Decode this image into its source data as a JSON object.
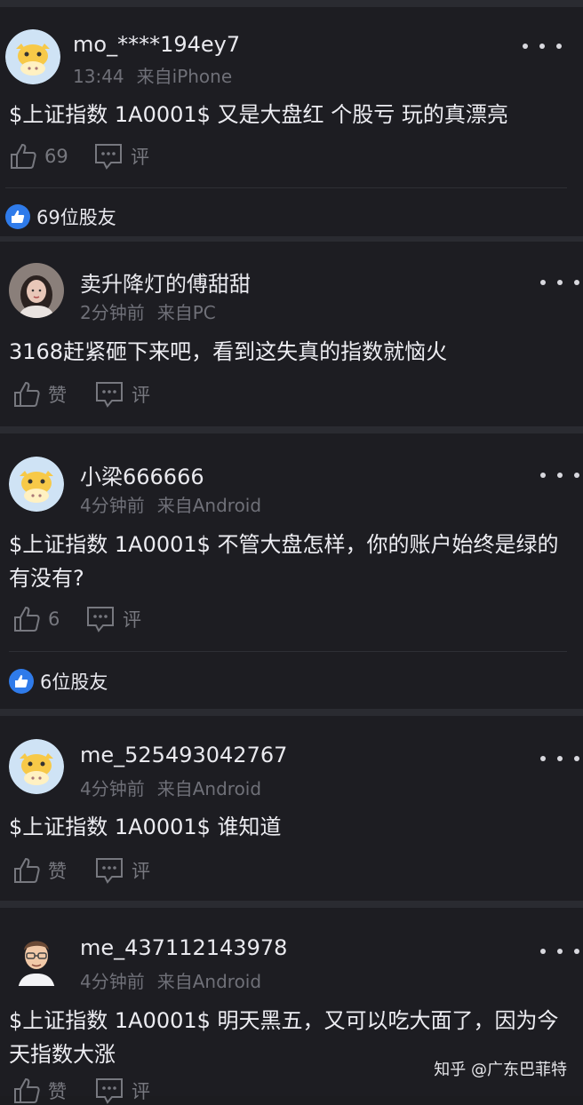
{
  "posts": [
    {
      "user": "mo_****194ey7",
      "time": "13:44",
      "source": "来自iPhone",
      "content": "$上证指数 1A0001$ 又是大盘红 个股亏 玩的真漂亮",
      "like_label": "69",
      "comment_label": "评",
      "likers_label": "69位股友",
      "avatar": "cow-avatar"
    },
    {
      "user": "卖升降灯的傅甜甜",
      "time": "2分钟前",
      "source": "来自PC",
      "content": "3168赶紧砸下来吧，看到这失真的指数就恼火",
      "like_label": "赞",
      "comment_label": "评",
      "avatar": "photo-avatar"
    },
    {
      "user": "小梁666666",
      "time": "4分钟前",
      "source": "来自Android",
      "content": "$上证指数 1A0001$ 不管大盘怎样，你的账户始终是绿的有没有?",
      "like_label": "6",
      "comment_label": "评",
      "likers_label": "6位股友",
      "avatar": "cow-avatar"
    },
    {
      "user": "me_525493042767",
      "time": "4分钟前",
      "source": "来自Android",
      "content": "$上证指数 1A0001$ 谁知道",
      "like_label": "赞",
      "comment_label": "评",
      "avatar": "cow-avatar"
    },
    {
      "user": "me_437112143978",
      "time": "4分钟前",
      "source": "来自Android",
      "content": "$上证指数 1A0001$ 明天黑五，又可以吃大面了，因为今天指数大涨",
      "like_label": "赞",
      "comment_label": "评",
      "avatar": "cartoon-avatar"
    }
  ],
  "watermark": "知乎 @广东巴菲特",
  "colors": {
    "background": "#1d1d22",
    "separator": "#2a2b31",
    "accent": "#2f7bea",
    "avatar_cow": "#f7c948"
  }
}
